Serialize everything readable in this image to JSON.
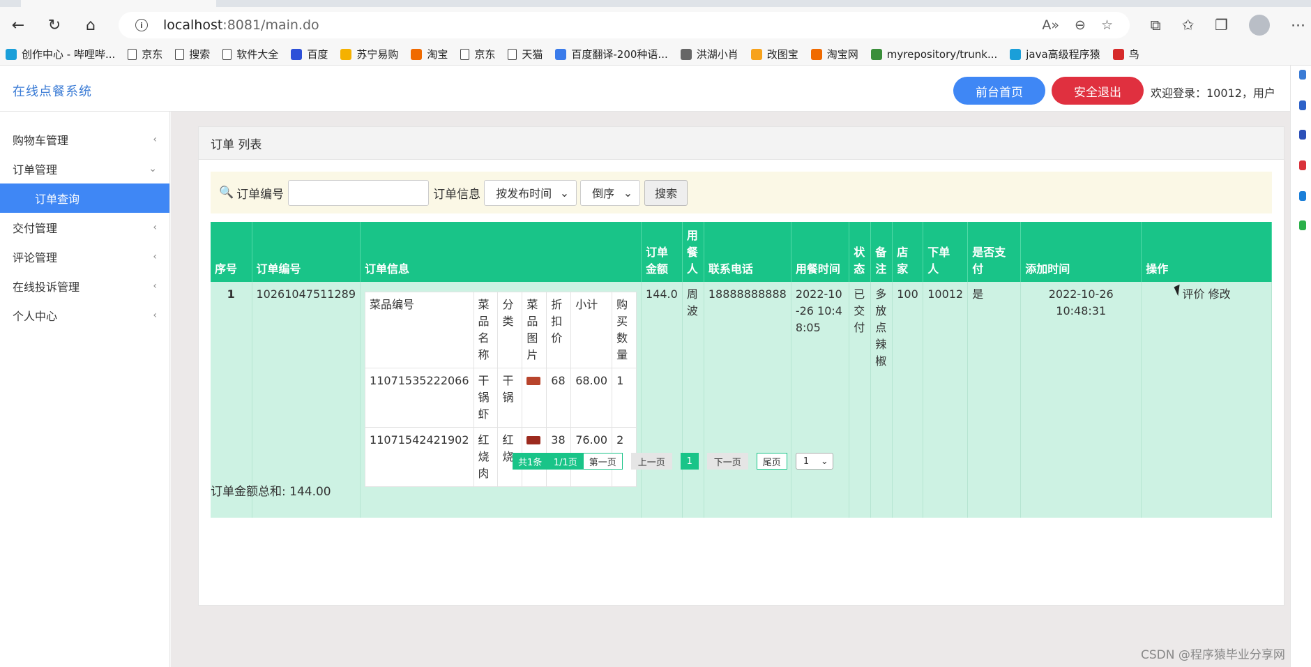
{
  "browser": {
    "url_host": "localhost",
    "url_port": ":8081/main.do"
  },
  "bookmarks": [
    {
      "label": "创作中心 - 哔哩哔...",
      "icon": "bilibili-icon",
      "color": "#1a9fd9"
    },
    {
      "label": "京东",
      "icon": "page-icon"
    },
    {
      "label": "搜索",
      "icon": "page-icon"
    },
    {
      "label": "软件大全",
      "icon": "page-icon"
    },
    {
      "label": "百度",
      "icon": "baidu-paw-icon",
      "color": "#2d50d8"
    },
    {
      "label": "苏宁易购",
      "icon": "suning-icon",
      "color": "#f5b100"
    },
    {
      "label": "淘宝",
      "icon": "taobao-icon",
      "color": "#f06a00"
    },
    {
      "label": "京东",
      "icon": "page-icon"
    },
    {
      "label": "天猫",
      "icon": "page-icon"
    },
    {
      "label": "百度翻译-200种语...",
      "icon": "baidu-translate-icon",
      "color": "#3a7bea"
    },
    {
      "label": "洪湖小肖",
      "icon": "bird-icon",
      "color": "#666666"
    },
    {
      "label": "改图宝",
      "icon": "gaitubao-icon",
      "color": "#f7a21b"
    },
    {
      "label": "淘宝网",
      "icon": "taobao-icon",
      "color": "#f06a00"
    },
    {
      "label": "myrepository/trunk...",
      "icon": "chrome-icon",
      "color": "#3a8e3a"
    },
    {
      "label": "java高级程序猿",
      "icon": "bilibili-icon",
      "color": "#1a9fd9"
    },
    {
      "label": "鸟",
      "icon": "bird-icon",
      "color": "#d62a2a"
    }
  ],
  "app": {
    "title": "在线点餐系统",
    "home_button": "前台首页",
    "logout_button": "安全退出",
    "welcome": "欢迎登录：10012，用户"
  },
  "sidebar": {
    "items": [
      {
        "label": "购物车管理",
        "chevron": "‹"
      },
      {
        "label": "订单管理",
        "chevron": "⌄"
      },
      {
        "label": "订单查询",
        "active": true
      },
      {
        "label": "交付管理",
        "chevron": "‹"
      },
      {
        "label": "评论管理",
        "chevron": "‹"
      },
      {
        "label": "在线投诉管理",
        "chevron": "‹"
      },
      {
        "label": "个人中心",
        "chevron": "‹"
      }
    ]
  },
  "panel": {
    "title": "订单 列表"
  },
  "search": {
    "order_no_label": "订单编号",
    "order_info_label": "订单信息",
    "sort_field": "按发布时间",
    "sort_order": "倒序",
    "search_button": "搜索"
  },
  "table": {
    "headers": {
      "seq": "序号",
      "order_no": "订单编号",
      "order_info": "订单信息",
      "amount": "订单金额",
      "diner": "用餐人",
      "phone": "联系电话",
      "meal_time": "用餐时间",
      "status": "状态",
      "remark": "备注",
      "shop": "店家",
      "orderer": "下单人",
      "paid": "是否支付",
      "added_time": "添加时间",
      "action": "操作"
    },
    "rows": [
      {
        "seq": "1",
        "order_no": "10261047511289",
        "amount": "144.0",
        "diner": "周波",
        "phone": "18888888888",
        "meal_time": "2022-10-26 10:48:05",
        "status": "已交付",
        "remark": "多放点辣椒",
        "shop": "100",
        "orderer": "10012",
        "paid": "是",
        "added_time": "2022-10-26 10:48:31",
        "action_review": "评价",
        "action_edit": "修改",
        "items_header": {
          "dish_no": "菜品编号",
          "dish_name": "菜品名称",
          "category": "分类",
          "dish_image": "菜品图片",
          "discount_price": "折扣价",
          "subtotal": "小计",
          "quantity": "购买数量"
        },
        "items": [
          {
            "dish_no": "11071535222066",
            "dish_name": "干锅虾",
            "category": "干锅",
            "image_color": "#b8442c",
            "discount_price": "68",
            "subtotal": "68.00",
            "quantity": "1"
          },
          {
            "dish_no": "11071542421902",
            "dish_name": "红烧肉",
            "category": "红烧",
            "image_color": "#9c2a1e",
            "discount_price": "38",
            "subtotal": "76.00",
            "quantity": "2"
          }
        ]
      }
    ]
  },
  "pagination": {
    "total": "共1条",
    "page_info": "1/1页",
    "first": "第一页",
    "prev": "上一页",
    "current": "1",
    "next": "下一页",
    "last": "尾页",
    "select_value": "1"
  },
  "summary": {
    "total_label": "订单金额总和: 144.00"
  },
  "watermark": "CSDN @程序猿毕业分享网",
  "colors": {
    "accent_blue": "#3f87f5",
    "danger_red": "#e0303f",
    "table_green": "#19c488",
    "row_mint": "#cdf2e3"
  }
}
